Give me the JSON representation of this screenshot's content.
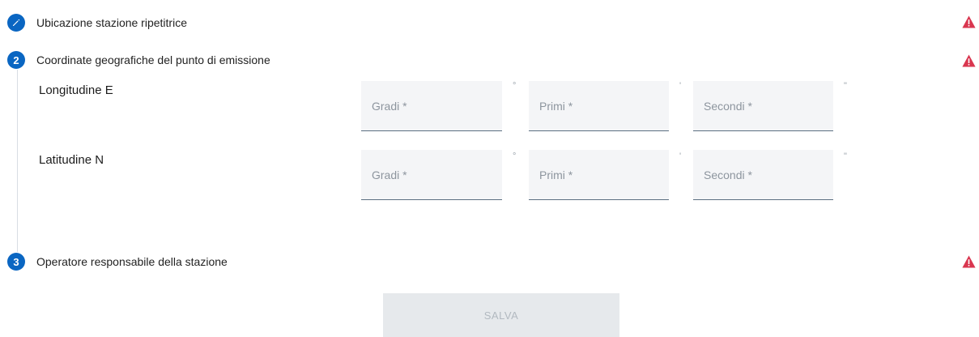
{
  "steps": [
    {
      "badge": "",
      "icon": "pencil-icon",
      "label": "Ubicazione stazione ripetitrice"
    },
    {
      "badge": "2",
      "label": "Coordinate geografiche del punto di emissione"
    },
    {
      "badge": "3",
      "label": "Operatore responsabile della stazione"
    }
  ],
  "coordinates": {
    "longitude": {
      "label": "Longitudine E",
      "degrees_placeholder": "Gradi *",
      "minutes_placeholder": "Primi *",
      "seconds_placeholder": "Secondi *"
    },
    "latitude": {
      "label": "Latitudine N",
      "degrees_placeholder": "Gradi *",
      "minutes_placeholder": "Primi *",
      "seconds_placeholder": "Secondi *"
    },
    "units": {
      "degrees": "°",
      "minutes": "'",
      "seconds": "\""
    }
  },
  "save_button": {
    "label": "SALVA"
  },
  "icons": {
    "step_badge": "step-number-icon",
    "warning": "warning-triangle-icon"
  },
  "colors": {
    "accent": "#0a66c2",
    "warning": "#d9364f",
    "field_background": "#f4f5f7",
    "button_disabled": "#e6e9ec"
  }
}
